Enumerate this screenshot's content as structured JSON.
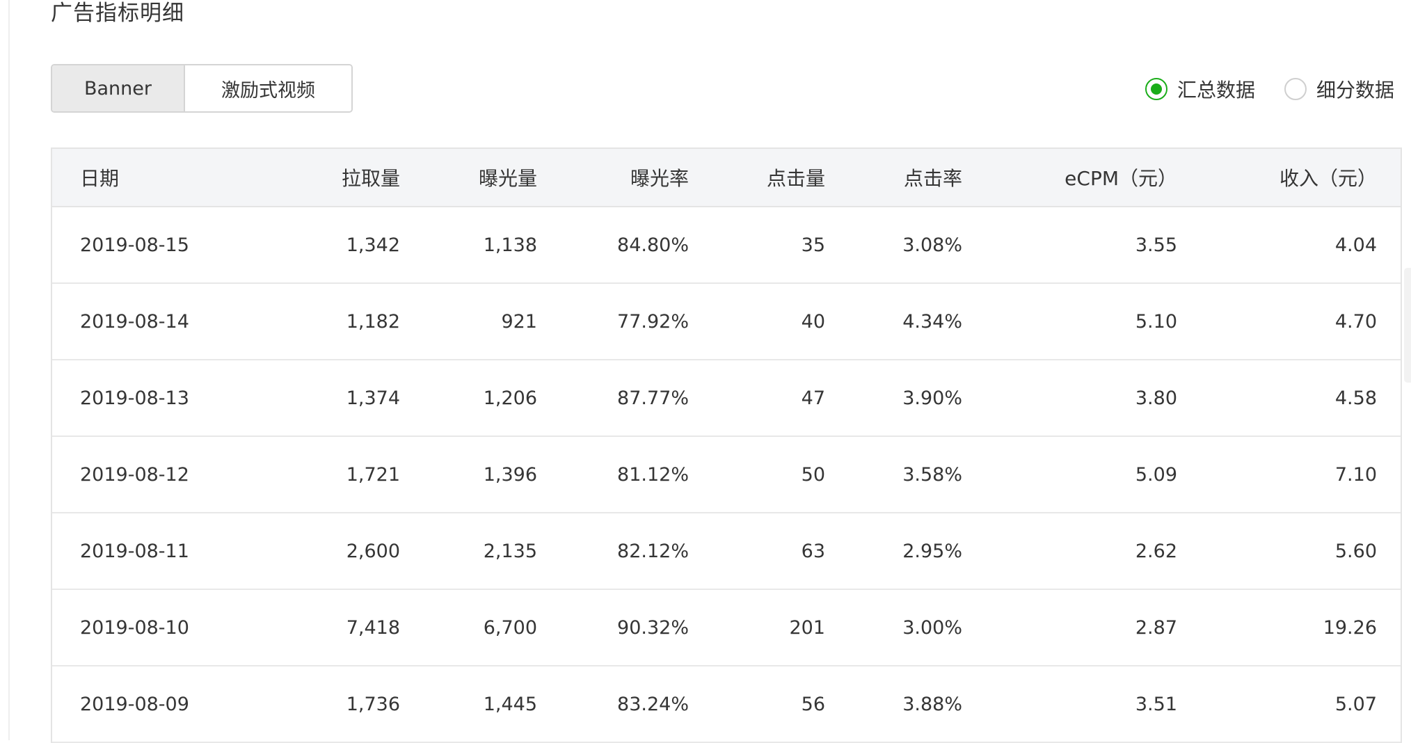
{
  "page": {
    "title": "广告指标明细"
  },
  "tabs": [
    {
      "label": "Banner",
      "active": true
    },
    {
      "label": "激励式视频",
      "active": false
    }
  ],
  "radios": [
    {
      "label": "汇总数据",
      "checked": true
    },
    {
      "label": "细分数据",
      "checked": false
    }
  ],
  "colors": {
    "accent": "#1aad19",
    "header_bg": "#f4f5f7",
    "active_tab_bg": "#eaeaea"
  },
  "table": {
    "columns": [
      "日期",
      "拉取量",
      "曝光量",
      "曝光率",
      "点击量",
      "点击率",
      "eCPM（元）",
      "收入（元）"
    ],
    "rows": [
      [
        "2019-08-15",
        "1,342",
        "1,138",
        "84.80%",
        "35",
        "3.08%",
        "3.55",
        "4.04"
      ],
      [
        "2019-08-14",
        "1,182",
        "921",
        "77.92%",
        "40",
        "4.34%",
        "5.10",
        "4.70"
      ],
      [
        "2019-08-13",
        "1,374",
        "1,206",
        "87.77%",
        "47",
        "3.90%",
        "3.80",
        "4.58"
      ],
      [
        "2019-08-12",
        "1,721",
        "1,396",
        "81.12%",
        "50",
        "3.58%",
        "5.09",
        "7.10"
      ],
      [
        "2019-08-11",
        "2,600",
        "2,135",
        "82.12%",
        "63",
        "2.95%",
        "2.62",
        "5.60"
      ],
      [
        "2019-08-10",
        "7,418",
        "6,700",
        "90.32%",
        "201",
        "3.00%",
        "2.87",
        "19.26"
      ],
      [
        "2019-08-09",
        "1,736",
        "1,445",
        "83.24%",
        "56",
        "3.88%",
        "3.51",
        "5.07"
      ]
    ]
  }
}
